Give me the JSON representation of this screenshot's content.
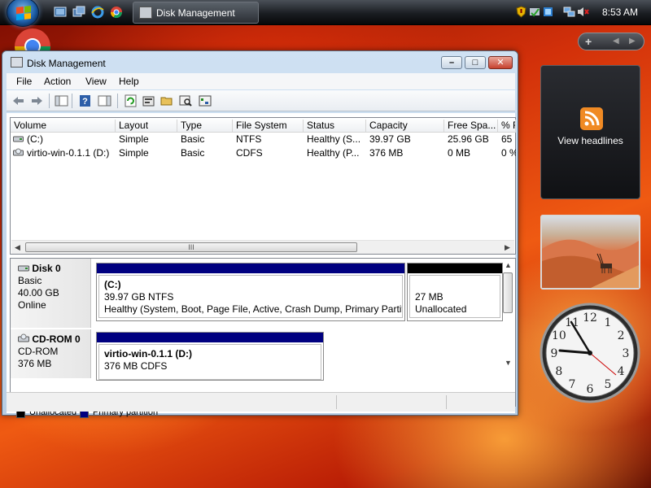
{
  "taskbar": {
    "task_button_label": "Disk Management",
    "clock": "8:53 AM"
  },
  "window": {
    "title": "Disk Management",
    "menu": [
      "File",
      "Action",
      "View",
      "Help"
    ]
  },
  "volume_list": {
    "columns": [
      "Volume",
      "Layout",
      "Type",
      "File System",
      "Status",
      "Capacity",
      "Free Spa...",
      "% F"
    ],
    "rows": [
      [
        "(C:)",
        "Simple",
        "Basic",
        "NTFS",
        "Healthy (S...",
        "39.97 GB",
        "25.96 GB",
        "65"
      ],
      [
        "virtio-win-0.1.1 (D:)",
        "Simple",
        "Basic",
        "CDFS",
        "Healthy (P...",
        "376 MB",
        "0 MB",
        "0 %"
      ]
    ],
    "scroll_grip": "III"
  },
  "disks": [
    {
      "name": "Disk 0",
      "type": "Basic",
      "size": "40.00 GB",
      "state": "Online",
      "partitions": [
        {
          "label": "(C:)",
          "size": "39.97 GB NTFS",
          "status": "Healthy (System, Boot, Page File, Active, Crash Dump, Primary Partiti",
          "kind": "primary"
        },
        {
          "label": "",
          "size": "27 MB",
          "status": "Unallocated",
          "kind": "unallocated"
        }
      ]
    },
    {
      "name": "CD-ROM 0",
      "type": "CD-ROM",
      "size": "376 MB",
      "state": "",
      "partitions": [
        {
          "label": "virtio-win-0.1.1  (D:)",
          "size": "376 MB CDFS",
          "status": "",
          "kind": "primary"
        }
      ]
    }
  ],
  "legend": [
    {
      "label": "Unallocated",
      "color": "#000000"
    },
    {
      "label": "Primary partition",
      "color": "#000080"
    }
  ],
  "gadgets": {
    "feeds_label": "View headlines",
    "clock_numbers": [
      "12",
      "1",
      "2",
      "3",
      "4",
      "5",
      "6",
      "7",
      "8",
      "9",
      "10",
      "11"
    ]
  },
  "colors": {
    "primary_partition": "#000080",
    "unallocated": "#000000",
    "accent": "#1d5ea7"
  }
}
